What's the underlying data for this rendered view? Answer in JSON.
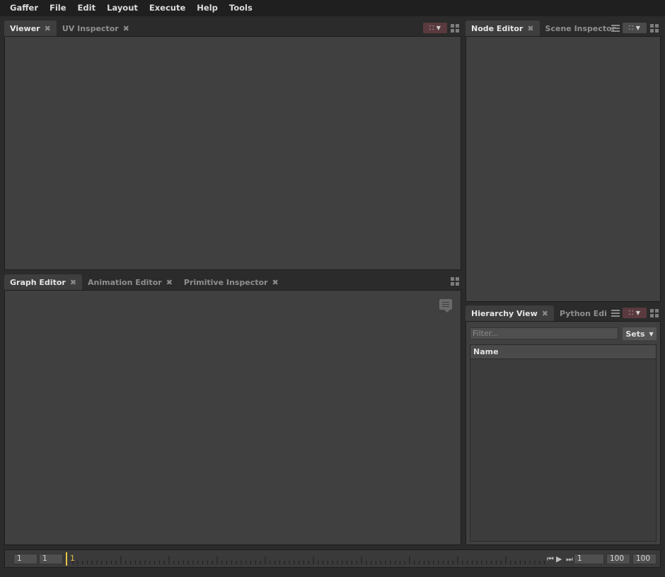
{
  "menu": [
    "Gaffer",
    "File",
    "Edit",
    "Layout",
    "Execute",
    "Help",
    "Tools"
  ],
  "viewer_panel": {
    "tabs": [
      {
        "label": "Viewer",
        "active": true
      },
      {
        "label": "UV Inspector",
        "active": false
      }
    ]
  },
  "graph_panel": {
    "tabs": [
      {
        "label": "Graph Editor",
        "active": true
      },
      {
        "label": "Animation Editor",
        "active": false
      },
      {
        "label": "Primitive Inspector",
        "active": false
      }
    ]
  },
  "node_panel": {
    "tabs": [
      {
        "label": "Node Editor",
        "active": true
      },
      {
        "label": "Scene Inspector",
        "active": false
      }
    ]
  },
  "hierarchy_panel": {
    "tabs": [
      {
        "label": "Hierarchy View",
        "active": true
      },
      {
        "label": "Python Editor",
        "active": false
      }
    ],
    "filter_placeholder": "Filter...",
    "sets_label": "Sets",
    "column_header": "Name"
  },
  "timeline": {
    "start": "1",
    "range_start": "1",
    "current_frame": "1",
    "current_frame_field": "1",
    "range_end": "100",
    "end": "100"
  },
  "colors": {
    "accent_playhead": "#e8c54a",
    "pin_button": "#5a3a3e",
    "panel_bg": "#404040"
  },
  "icons": [
    "close-icon",
    "layout-grid-icon",
    "pin-icon",
    "menu-icon",
    "note-icon",
    "chevron-down-icon",
    "skip-start-icon",
    "play-icon",
    "skip-end-icon"
  ]
}
